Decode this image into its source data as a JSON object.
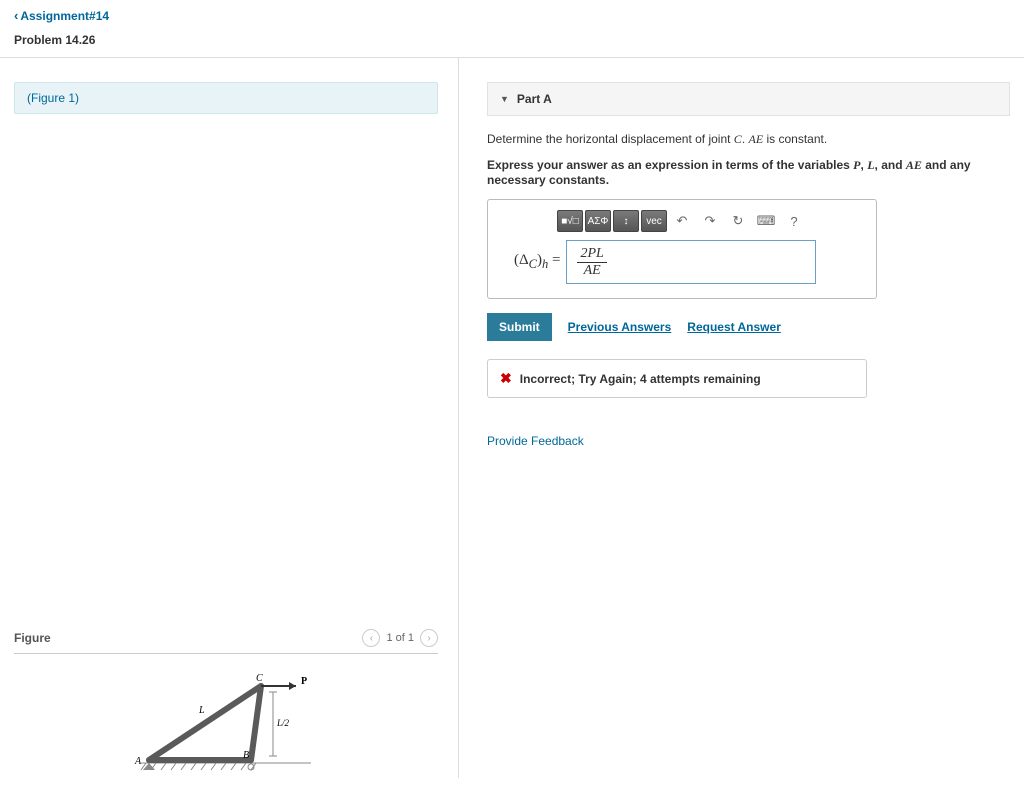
{
  "header": {
    "assignment_link": "Assignment#14",
    "problem_title": "Problem 14.26"
  },
  "left": {
    "figure_link": "(Figure 1)",
    "figure_label": "Figure",
    "pager_text": "1 of 1",
    "diagram": {
      "A": "A",
      "B": "B",
      "C": "C",
      "P": "P",
      "L": "L",
      "L2": "L/2"
    }
  },
  "part": {
    "label": "Part A",
    "question_pre": "Determine the horizontal displacement of joint ",
    "question_var1": "C",
    "question_mid": ". ",
    "question_var2": "AE",
    "question_post": " is constant.",
    "instruction_pre": "Express your answer as an expression in terms of the variables ",
    "vars": {
      "P": "P",
      "L": "L",
      "AE": "AE"
    },
    "instruction_post": " and any necessary constants.",
    "lhs": "(Δ_C)_h =",
    "answer_num": "2PL",
    "answer_den": "AE",
    "toolbar": {
      "t1": "■√□",
      "t2": "ΑΣΦ",
      "t3": "↕",
      "t4": "vec",
      "undo": "↶",
      "redo": "↷",
      "reset": "↻",
      "kbd": "⌨",
      "help": "?"
    },
    "submit": "Submit",
    "prev_answers": "Previous Answers",
    "request_answer": "Request Answer",
    "feedback_text": "Incorrect; Try Again; 4 attempts remaining",
    "provide_feedback": "Provide Feedback"
  }
}
